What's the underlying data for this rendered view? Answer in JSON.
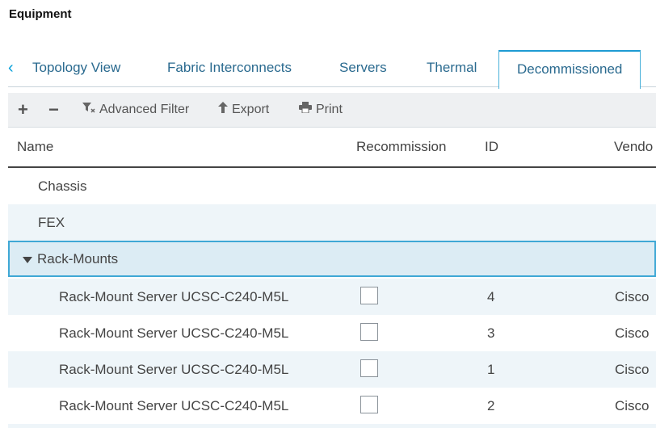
{
  "page": {
    "title": "Equipment"
  },
  "tabs": {
    "back_icon": "chevron-left-icon",
    "items": [
      {
        "label": "Topology View"
      },
      {
        "label": "Fabric Interconnects"
      },
      {
        "label": "Servers"
      },
      {
        "label": "Thermal"
      },
      {
        "label": "Decommissioned"
      }
    ],
    "active": "Decommissioned"
  },
  "toolbar": {
    "add_label": "+",
    "remove_label": "−",
    "filter_label": "Advanced Filter",
    "export_label": "Export",
    "print_label": "Print"
  },
  "table": {
    "columns": [
      "Name",
      "Recommission",
      "ID",
      "Vendo"
    ],
    "groups": [
      {
        "name": "Chassis"
      },
      {
        "name": "FEX"
      },
      {
        "name": "Rack-Mounts",
        "expanded": true
      }
    ],
    "rows": [
      {
        "name": "Rack-Mount Server UCSC-C240-M5L",
        "recommission": false,
        "id": "4",
        "vendor": "Cisco"
      },
      {
        "name": "Rack-Mount Server UCSC-C240-M5L",
        "recommission": false,
        "id": "3",
        "vendor": "Cisco"
      },
      {
        "name": "Rack-Mount Server UCSC-C240-M5L",
        "recommission": false,
        "id": "1",
        "vendor": "Cisco"
      },
      {
        "name": "Rack-Mount Server UCSC-C240-M5L",
        "recommission": false,
        "id": "2",
        "vendor": "Cisco"
      }
    ]
  },
  "colors": {
    "accent": "#049fd9",
    "selected_border": "#3fa8d5",
    "alt_row": "#eef5f9"
  }
}
